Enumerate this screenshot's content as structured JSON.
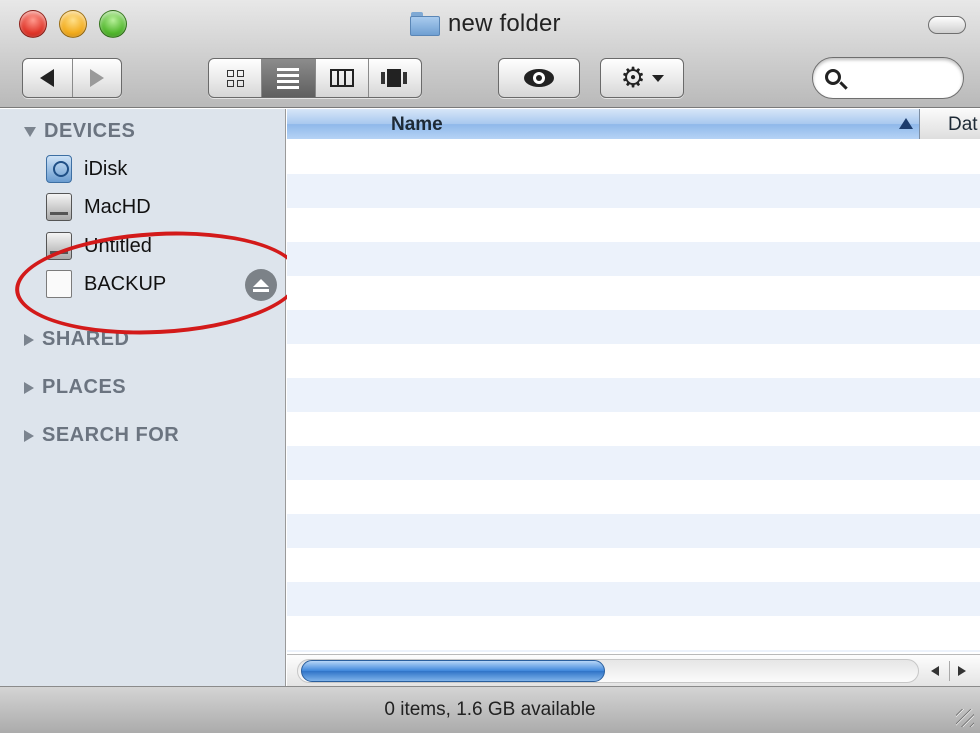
{
  "window": {
    "title": "new folder",
    "status": "0 items, 1.6 GB available"
  },
  "toolbar": {
    "search": {
      "value": "",
      "placeholder": ""
    }
  },
  "sidebar": {
    "devices": {
      "header": "DEVICES",
      "items": [
        {
          "label": "iDisk",
          "icon": "idisk-icon"
        },
        {
          "label": "MacHD",
          "icon": "hard-drive-icon"
        },
        {
          "label": "Untitled",
          "icon": "hard-drive-icon"
        },
        {
          "label": "BACKUP",
          "icon": "external-drive-icon",
          "ejectable": true,
          "highlighted_by_annotation": true
        }
      ]
    },
    "shared": {
      "header": "SHARED"
    },
    "places": {
      "header": "PLACES"
    },
    "search_for": {
      "header": "SEARCH FOR"
    }
  },
  "list": {
    "columns": [
      {
        "label": "Name",
        "sorted": "ascending"
      },
      {
        "label": "Dat"
      }
    ],
    "rows": []
  },
  "colors": {
    "sidebar_bg": "#dde4ec",
    "selected_column": "#a8c8ef",
    "annotation_ring": "#d31a1a",
    "scroll_thumb": "#3d86db"
  }
}
